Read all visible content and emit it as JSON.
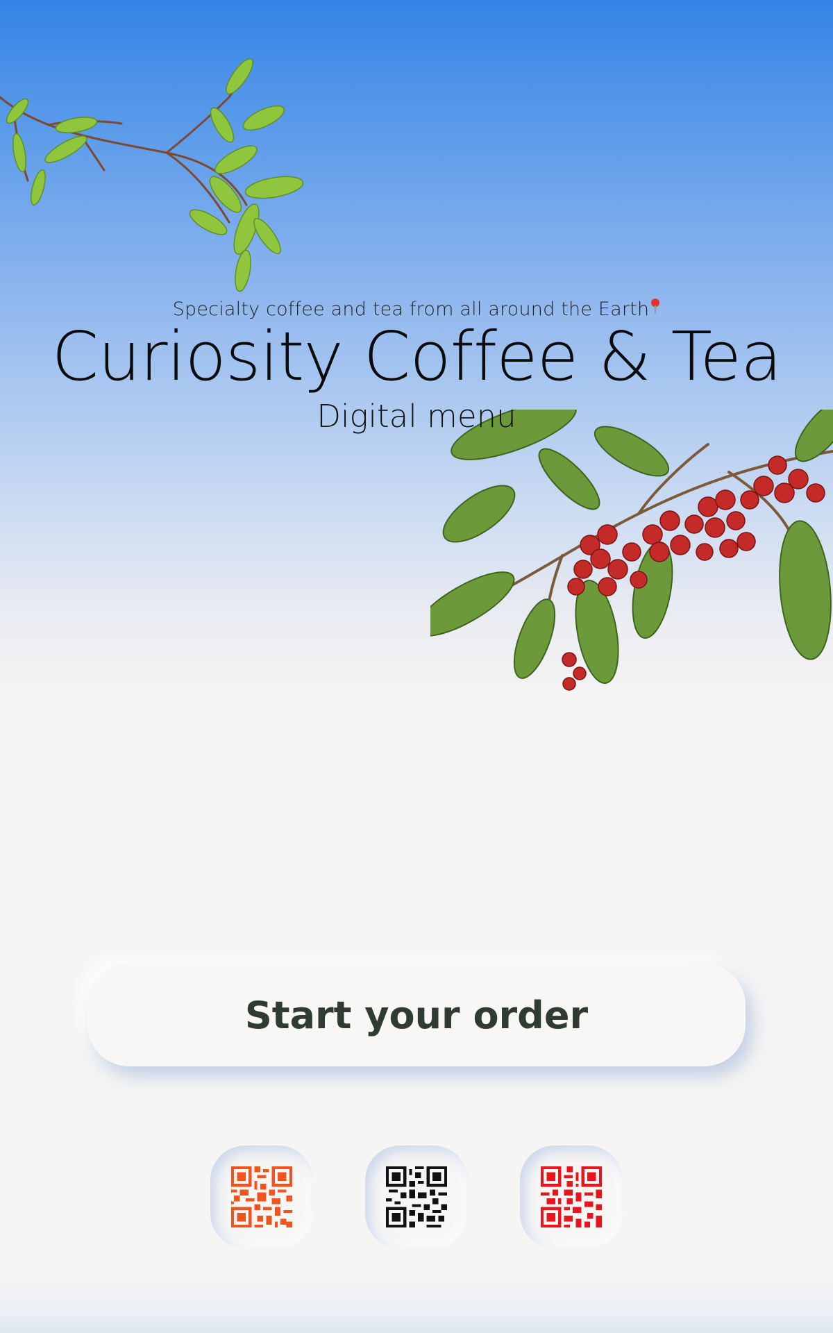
{
  "header": {
    "tagline": "Specialty coffee and tea from all around the Earth",
    "title": "Curiosity Coffee & Tea",
    "subtitle": "Digital menu"
  },
  "actions": {
    "start_order_label": "Start your order"
  },
  "qr_codes": [
    {
      "icon": "qr-code-icon",
      "color": "#f0541e"
    },
    {
      "icon": "qr-code-icon",
      "color": "#111111"
    },
    {
      "icon": "qr-code-icon",
      "color": "#e8141e"
    }
  ],
  "colors": {
    "sky_top": "#3484e6",
    "background": "#f6f5f4",
    "button_text": "#2f3b33"
  }
}
